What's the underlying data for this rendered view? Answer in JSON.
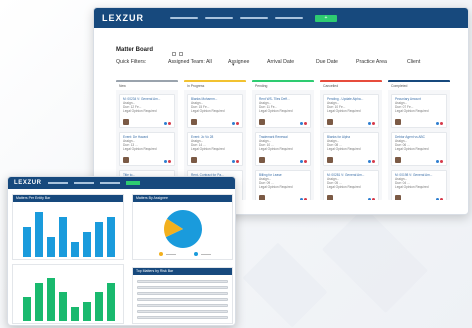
{
  "app": {
    "logo": "LEXZUR"
  },
  "topbar": {
    "nav_count": 4,
    "action_label": "+"
  },
  "board": {
    "title": "Matter Board",
    "filters": {
      "quick_filters": "Quick Filters:",
      "assigned_team": "Assigned Team: All",
      "assignee": "Assignee",
      "arrival_date": "Arrival Date",
      "due_date": "Due Date",
      "practice_area": "Practice Area",
      "client": "Client"
    },
    "columns": [
      {
        "name": "New",
        "color": "#9aa3ad",
        "cards": [
          {
            "l1": "M: 00234 V: General Am...",
            "l2": "Assign...",
            "l3": "Due: 12 Fe...",
            "l4": "Legal Opinion Required"
          },
          {
            "l1": "Event: De Hazard",
            "l2": "Assign...",
            "l3": "Due: 13 ...",
            "l4": "Legal Opinion Required"
          },
          {
            "l1": "Title to...",
            "l2": "",
            "l3": "",
            "l4": ""
          }
        ]
      },
      {
        "name": "In Progress",
        "color": "#f2c230",
        "cards": [
          {
            "l1": "Blanks Mohamm...",
            "l2": "Assign...",
            "l3": "Due: 15 Fe...",
            "l4": "Legal Opinion Required"
          },
          {
            "l1": "Event: Jo Vo 28",
            "l2": "Assign...",
            "l3": "Due: 14 ...",
            "l4": "Legal Opinion Required"
          },
          {
            "l1": "Rent- Contract for Pa...",
            "l2": "",
            "l3": "",
            "l4": ""
          }
        ]
      },
      {
        "name": "Pending",
        "color": "#2ecc71",
        "cards": [
          {
            "l1": "Rent WS- Tiles Deff...",
            "l2": "Assign...",
            "l3": "Due: 11 Fe...",
            "l4": "Legal Opinion Required"
          },
          {
            "l1": "Trademark Renewal",
            "l2": "Assign...",
            "l3": "Due: 10 ...",
            "l4": "Legal Opinion Required"
          },
          {
            "l1": "Billing for Lease",
            "l2": "Assign...",
            "l3": "Due: 09 ...",
            "l4": "Legal Opinion Required"
          }
        ]
      },
      {
        "name": "Cancelled",
        "color": "#e74c3c",
        "cards": [
          {
            "l1": "Pending - Update Alpha...",
            "l2": "Assign...",
            "l3": "Due: 10 Fe...",
            "l4": "Legal Opinion Required"
          },
          {
            "l1": "Blanks for Alpha",
            "l2": "Assign...",
            "l3": "Due: 08 ...",
            "l4": "Legal Opinion Required"
          },
          {
            "l1": "M: 00281 V: General Am...",
            "l2": "Assign...",
            "l3": "Due: 05 ...",
            "l4": "Legal Opinion Required"
          }
        ]
      },
      {
        "name": "Completed",
        "color": "#17497d",
        "cards": [
          {
            "l1": "Pecuniary Amount",
            "l2": "Assign...",
            "l3": "Due: 07 Fe...",
            "l4": "Legal Opinion Required"
          },
          {
            "l1": "Debtor Agent vs ABC",
            "l2": "Assign...",
            "l3": "Due: 06 ...",
            "l4": "Legal Opinion Required"
          },
          {
            "l1": "M: 00198 V: General Am...",
            "l2": "Assign...",
            "l3": "Due: 04 ...",
            "l4": "Legal Opinion Required"
          }
        ]
      }
    ]
  },
  "dashboard": {
    "logo": "LEXZUR",
    "panel_top_left": "Matters Per Entity Bar",
    "panel_top_right": "Matters By Assignee",
    "panel_bottom_right": "Top Matters by Risk Bar",
    "colors": {
      "blue": "#1a9bdc",
      "green": "#19b96e",
      "pie_main": "#1a9bdc",
      "pie_slice": "#f2b01e"
    }
  },
  "chart_data": [
    {
      "type": "bar",
      "series": [
        {
          "values": [
            6,
            9,
            4,
            8,
            3,
            5,
            7,
            8
          ]
        }
      ],
      "categories": [
        "",
        "",
        "",
        "",
        "",
        "",
        "",
        ""
      ],
      "title": "",
      "xlabel": "",
      "ylabel": "",
      "ylim": [
        0,
        10
      ]
    },
    {
      "type": "bar",
      "series": [
        {
          "values": [
            5,
            8,
            9,
            6,
            3,
            4,
            6,
            8
          ]
        }
      ],
      "categories": [
        "",
        "",
        "",
        "",
        "",
        "",
        "",
        ""
      ],
      "title": "",
      "xlabel": "",
      "ylabel": "",
      "ylim": [
        0,
        10
      ]
    },
    {
      "type": "pie",
      "slices": [
        {
          "label": "",
          "value": 84
        },
        {
          "label": "",
          "value": 16
        }
      ]
    }
  ]
}
